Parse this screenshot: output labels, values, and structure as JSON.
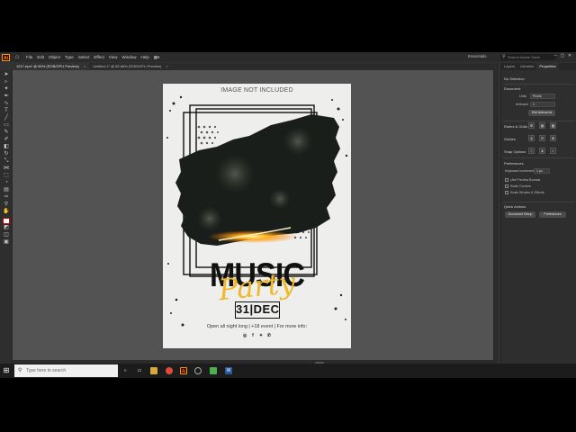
{
  "menubar": {
    "logo": "Ai",
    "menus": [
      "File",
      "Edit",
      "Object",
      "Type",
      "Select",
      "Effect",
      "View",
      "Window",
      "Help"
    ],
    "workspace": "Essentials",
    "search_placeholder": "Search Adobe Stock"
  },
  "tabs": [
    {
      "label": "1017.eps* @ 80% (RGB/GPU Preview)",
      "active": true
    },
    {
      "label": "Untitled-1* @ 85.68% (RGB/GPU Preview)",
      "active": false
    }
  ],
  "statusbar": {
    "zoom": "80%",
    "tool": "Selection"
  },
  "panel": {
    "tabs": [
      "Layers",
      "Libraries",
      "Properties"
    ],
    "no_selection": "No Selection",
    "document_label": "Document",
    "units_label": "Units",
    "units_value": "Pixels",
    "artboard_label": "Artboard",
    "artboard_value": "1",
    "edit_artboards": "Edit Artboards",
    "rulers_grids": "Rulers & Grids",
    "guides": "Guides",
    "snap_options": "Snap Options",
    "preferences_label": "Preferences",
    "keyboard_increment_label": "Keyboard Increment",
    "keyboard_increment_value": "1 px",
    "use_preview_bounds": "Use Preview Bounds",
    "scale_corners": "Scale Corners",
    "scale_strokes": "Scale Strokes & Effects",
    "quick_actions": "Quick Actions",
    "document_setup": "Document Setup",
    "preferences_btn": "Preferences"
  },
  "poster": {
    "image_note": "IMAGE NOT INCLUDED",
    "title": "MUSIC",
    "script": "Party",
    "date": "31|DEC",
    "info": "Open all night long  |  +18 event  |  For more info:",
    "colors": {
      "accent": "#f0b92a",
      "dark": "#111111",
      "paper": "#eeeeec"
    }
  },
  "taskbar": {
    "search_placeholder": "Type here to search"
  }
}
